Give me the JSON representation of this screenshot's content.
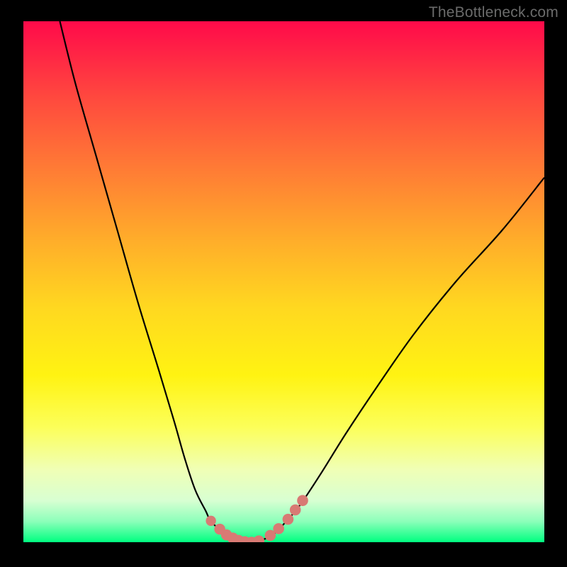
{
  "watermark": "TheBottleneck.com",
  "colors": {
    "page_bg": "#000000",
    "gradient_top": "#ff0a4a",
    "gradient_bottom": "#00ff80",
    "curve_stroke": "#000000",
    "dot_fill": "#d87a74",
    "watermark_text": "#6b6b6b"
  },
  "chart_data": {
    "type": "line",
    "title": "",
    "xlabel": "",
    "ylabel": "",
    "xlim": [
      0,
      100
    ],
    "ylim": [
      0,
      100
    ],
    "curve": {
      "x": [
        7,
        10,
        14,
        18,
        22,
        26,
        29,
        31,
        33,
        35,
        36,
        38,
        40,
        42,
        44,
        46,
        48,
        50,
        53,
        57,
        62,
        68,
        75,
        83,
        92,
        100
      ],
      "pct": [
        100,
        88,
        74,
        60,
        46,
        33,
        23,
        16,
        10,
        6,
        4,
        2.2,
        1,
        0.2,
        0,
        0.5,
        1.5,
        3.5,
        7,
        13,
        21,
        30,
        40,
        50,
        60,
        70
      ]
    },
    "markers": {
      "x": [
        36.0,
        37.7,
        39.0,
        40.2,
        41.3,
        42.5,
        43.8,
        45.2,
        47.4,
        49.0,
        50.8,
        52.2,
        53.6
      ],
      "pct": [
        4.1,
        2.5,
        1.4,
        0.8,
        0.35,
        0.1,
        0.0,
        0.25,
        1.3,
        2.6,
        4.4,
        6.2,
        8.0
      ]
    }
  }
}
